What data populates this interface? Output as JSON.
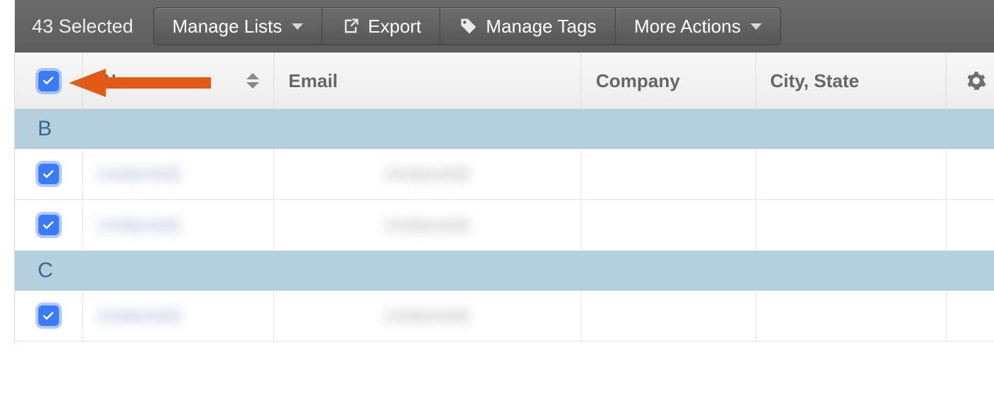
{
  "toolbar": {
    "selected_count_label": "43 Selected",
    "manage_lists_label": "Manage Lists",
    "export_label": "Export",
    "manage_tags_label": "Manage Tags",
    "more_actions_label": "More Actions"
  },
  "columns": {
    "name": "Name",
    "email": "Email",
    "company": "Company",
    "city_state": "City, State"
  },
  "groups": [
    {
      "letter": "B",
      "rows": [
        {
          "checked": true,
          "name": "(redacted)",
          "email": "(redacted)",
          "company": "",
          "city_state": ""
        },
        {
          "checked": true,
          "name": "(redacted)",
          "email": "(redacted)",
          "company": "",
          "city_state": ""
        }
      ]
    },
    {
      "letter": "C",
      "rows": [
        {
          "checked": true,
          "name": "(redacted)",
          "email": "(redacted)",
          "company": "",
          "city_state": ""
        }
      ]
    }
  ]
}
